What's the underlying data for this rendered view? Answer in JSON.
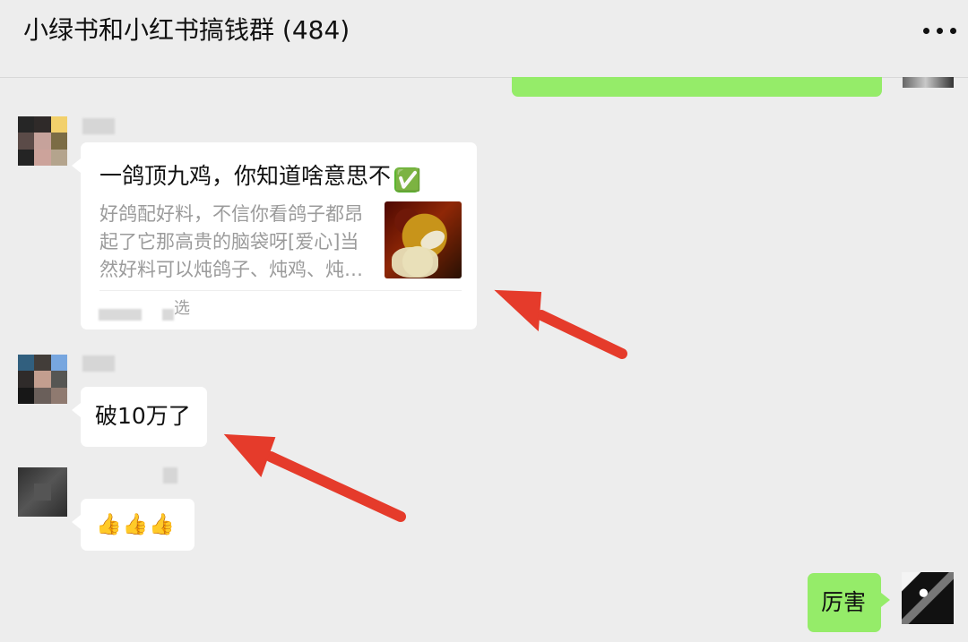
{
  "header": {
    "title": "小绿书和小红书搞钱群 (484)",
    "more_icon": "more-icon"
  },
  "messages": {
    "share": {
      "title": "一鸽顶九鸡，你知道啥意思不",
      "check_icon": "✅",
      "description": "好鸽配好料，不信你看鸽子都昂起了它那高贵的脑袋呀[爱心]当然好料可以炖鸽子、炖鸡、炖…",
      "source": "选"
    },
    "text_message": "破10万了",
    "emoji_message": "👍👍👍",
    "reply": "厉害"
  },
  "annotations": {
    "arrow_color": "#e53b2b"
  }
}
